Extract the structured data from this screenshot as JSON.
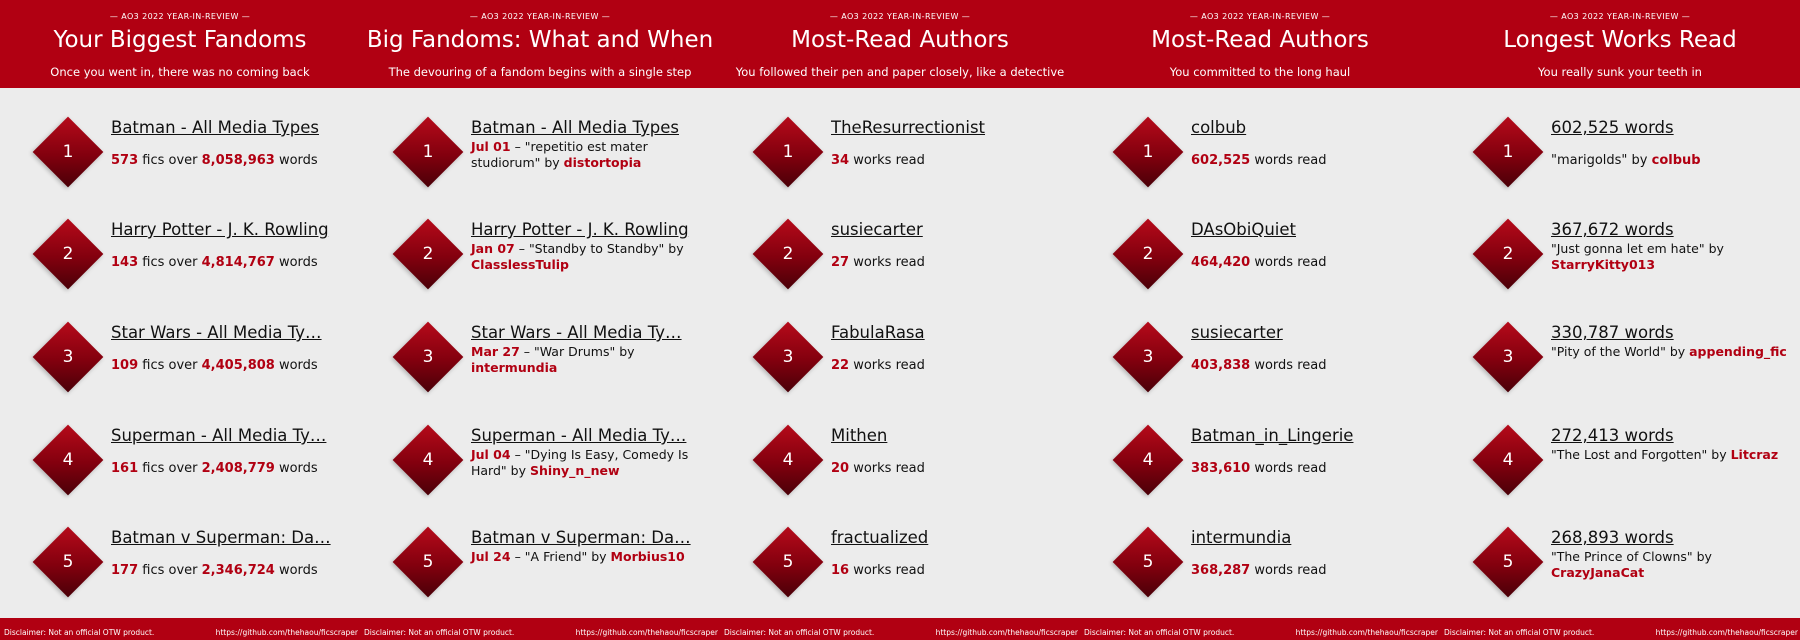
{
  "panels": [
    {
      "eyebrow": "— AO3 2022 YEAR-IN-REVIEW —",
      "title": "Your Biggest Fandoms",
      "subtitle": "Once you went in, there was no coming back",
      "items": [
        {
          "rank": "1",
          "name": "Batman - All Media Types",
          "fics": "573",
          "mid": " fics over ",
          "words": "8,058,963",
          "end": " words"
        },
        {
          "rank": "2",
          "name": "Harry Potter - J. K. Rowling",
          "fics": "143",
          "mid": " fics over ",
          "words": "4,814,767",
          "end": " words"
        },
        {
          "rank": "3",
          "name": "Star Wars - All Media Ty…",
          "fics": "109",
          "mid": " fics over ",
          "words": "4,405,808",
          "end": " words"
        },
        {
          "rank": "4",
          "name": "Superman - All Media Ty…",
          "fics": "161",
          "mid": " fics over ",
          "words": "2,408,779",
          "end": " words"
        },
        {
          "rank": "5",
          "name": "Batman v Superman: Da…",
          "fics": "177",
          "mid": " fics over ",
          "words": "2,346,724",
          "end": " words"
        }
      ],
      "footer": {
        "disclaimer": "Disclaimer: Not an official OTW product.",
        "url": "https://github.com/thehaou/ficscraper"
      }
    },
    {
      "eyebrow": "— AO3 2022 YEAR-IN-REVIEW —",
      "title": "Big Fandoms: What and When",
      "subtitle": "The devouring of a fandom begins with a single step",
      "items": [
        {
          "rank": "1",
          "name": "Batman - All Media Types",
          "date": "Jul 01",
          "dash": " – ",
          "work": "\"repetitio est mater studiorum\"",
          "by": " by ",
          "author": "distortopia"
        },
        {
          "rank": "2",
          "name": "Harry Potter - J. K. Rowling",
          "date": "Jan 07",
          "dash": " – ",
          "work": "\"Standby to Standby\"",
          "by": " by ",
          "author": "ClasslessTulip"
        },
        {
          "rank": "3",
          "name": "Star Wars - All Media Ty…",
          "date": "Mar 27",
          "dash": " – ",
          "work": "\"War Drums\"",
          "by": " by ",
          "author": "intermundia"
        },
        {
          "rank": "4",
          "name": "Superman - All Media Ty…",
          "date": "Jul 04",
          "dash": " – ",
          "work": "\"Dying Is Easy, Comedy Is Hard\"",
          "by": " by ",
          "author": "Shiny_n_new"
        },
        {
          "rank": "5",
          "name": "Batman v Superman: Da…",
          "date": "Jul 24",
          "dash": " – ",
          "work": "\"A Friend\"",
          "by": " by ",
          "author": "Morbius10"
        }
      ],
      "footer": {
        "disclaimer": "Disclaimer: Not an official OTW product.",
        "url": "https://github.com/thehaou/ficscraper"
      }
    },
    {
      "eyebrow": "— AO3 2022 YEAR-IN-REVIEW —",
      "title": "Most-Read Authors",
      "subtitle": "You followed their pen and paper closely, like a detective",
      "items": [
        {
          "rank": "1",
          "name": "TheResurrectionist",
          "count": "34",
          "label": " works read"
        },
        {
          "rank": "2",
          "name": "susiecarter",
          "count": "27",
          "label": " works read"
        },
        {
          "rank": "3",
          "name": "FabulaRasa",
          "count": "22",
          "label": " works read"
        },
        {
          "rank": "4",
          "name": "Mithen",
          "count": "20",
          "label": " works read"
        },
        {
          "rank": "5",
          "name": "fractualized",
          "count": "16",
          "label": " works read"
        }
      ],
      "footer": {
        "disclaimer": "Disclaimer: Not an official OTW product.",
        "url": "https://github.com/thehaou/ficscraper"
      }
    },
    {
      "eyebrow": "— AO3 2022 YEAR-IN-REVIEW —",
      "title": "Most-Read Authors",
      "subtitle": "You committed to the long haul",
      "items": [
        {
          "rank": "1",
          "name": "colbub",
          "count": "602,525",
          "label": " words read"
        },
        {
          "rank": "2",
          "name": "DAsObiQuiet",
          "count": "464,420",
          "label": " words read"
        },
        {
          "rank": "3",
          "name": "susiecarter",
          "count": "403,838",
          "label": " words read"
        },
        {
          "rank": "4",
          "name": "Batman_in_Lingerie",
          "count": "383,610",
          "label": " words read"
        },
        {
          "rank": "5",
          "name": "intermundia",
          "count": "368,287",
          "label": " words read"
        }
      ],
      "footer": {
        "disclaimer": "Disclaimer: Not an official OTW product.",
        "url": "https://github.com/thehaou/ficscraper"
      }
    },
    {
      "eyebrow": "— AO3 2022 YEAR-IN-REVIEW —",
      "title": "Longest Works Read",
      "subtitle": "You really sunk your teeth in",
      "items": [
        {
          "rank": "1",
          "name": "602,525 words",
          "work": "\"marigolds\"",
          "by": " by ",
          "author": "colbub"
        },
        {
          "rank": "2",
          "name": "367,672 words",
          "work": "\"Just gonna let em hate\"",
          "by": " by ",
          "author": "StarryKitty013"
        },
        {
          "rank": "3",
          "name": "330,787 words",
          "work": "\"Pity of the World\"",
          "by": " by ",
          "author": "appending_fic"
        },
        {
          "rank": "4",
          "name": "272,413 words",
          "work": "\"The Lost and Forgotten\"",
          "by": " by ",
          "author": "Litcraz"
        },
        {
          "rank": "5",
          "name": "268,893 words",
          "work": "\"The Prince of Clowns\"",
          "by": " by ",
          "author": "CrazyJanaCat"
        }
      ],
      "footer": {
        "disclaimer": "Disclaimer: Not an official OTW product.",
        "url": "https://github.com/thehaou/ficscraper"
      }
    }
  ]
}
